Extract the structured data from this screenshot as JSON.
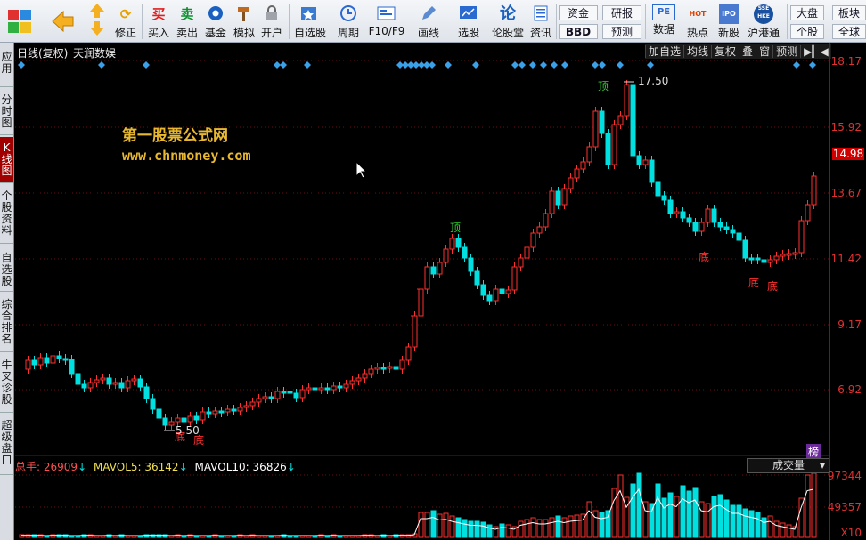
{
  "toolbar": {
    "buttons": [
      {
        "label": "修正",
        "icon": "refresh-icon"
      },
      {
        "label": "买入",
        "icon": "buy-icon",
        "glyph": "买"
      },
      {
        "label": "卖出",
        "icon": "sell-icon",
        "glyph": "卖"
      },
      {
        "label": "基金",
        "icon": "fund-icon"
      },
      {
        "label": "模拟",
        "icon": "hammer-icon"
      },
      {
        "label": "开户",
        "icon": "lock-icon"
      },
      {
        "label": "自选股",
        "icon": "watchlist-icon"
      },
      {
        "label": "周期",
        "icon": "clock-icon"
      },
      {
        "label": "F10/F9",
        "icon": "f10-icon"
      },
      {
        "label": "画线",
        "icon": "pen-icon"
      },
      {
        "label": "选股",
        "icon": "screen-icon"
      },
      {
        "label": "论股堂",
        "icon": "forum-icon",
        "glyph": "论"
      },
      {
        "label": "资讯",
        "icon": "news-icon"
      },
      {
        "label": "数据",
        "icon": "pe-icon",
        "glyph": "PE"
      },
      {
        "label": "热点",
        "icon": "hot-icon",
        "glyph": "HOT"
      },
      {
        "label": "新股",
        "icon": "ipo-icon",
        "glyph": "IPO"
      },
      {
        "label": "沪港通",
        "icon": "hk-connect-icon",
        "glyph": "SSE HKE"
      }
    ],
    "small_buttons": [
      "资金",
      "BBD",
      "研报",
      "预测",
      "大盘",
      "个股",
      "板块",
      "全球"
    ]
  },
  "left_tabs": [
    "应用",
    "分时图",
    "K线图",
    "个股资料",
    "自选股",
    "综合排名",
    "牛叉诊股",
    "超级盘口"
  ],
  "chart": {
    "period_label": "日线(复权)",
    "stock_name": "天润数娱",
    "cmd_buttons": [
      "加自选",
      "均线",
      "复权",
      "叠",
      "窗",
      "预测"
    ],
    "watermark_title": "第一股票公式网",
    "watermark_url": "www.chnmoney.com",
    "price_labels": [
      "18.17",
      "15.92",
      "13.67",
      "11.42",
      "9.17",
      "6.92"
    ],
    "current_price": "14.98",
    "high_marker": "17.50",
    "low_marker": "5.50",
    "top_label": "顶",
    "bottom_label": "底",
    "side_tag": "榜"
  },
  "volume": {
    "label_total": "总手:",
    "total": "26909",
    "ma5_label": "MAVOL5:",
    "ma5": "36142",
    "ma10_label": "MAVOL10:",
    "ma10": "36826",
    "selector": "成交量",
    "scale": [
      "97344",
      "49357",
      "X10"
    ]
  },
  "colors": {
    "up": "#ff3030",
    "down": "#00e0e0",
    "signal": "#3aa0e8",
    "accent": "#e8b830"
  }
}
